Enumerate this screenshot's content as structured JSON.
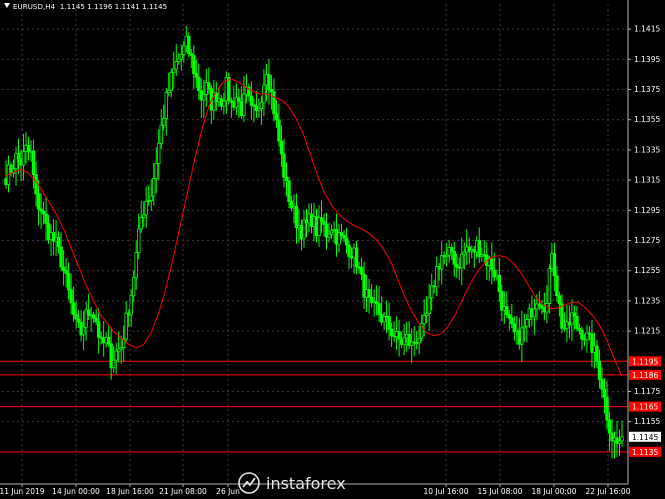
{
  "header": {
    "symbol_tf": "EURUSD,H4",
    "ohlc": "1.1145 1.1196 1.1141 1.1145"
  },
  "watermark": {
    "text": "instaforex"
  },
  "colors": {
    "background": "#000000",
    "candle": "#00ff00",
    "ma": "#ff0000",
    "level": "#ff0000",
    "grid": "#3a3a3a"
  },
  "chart_data": {
    "type": "candlestick",
    "symbol": "EURUSD",
    "timeframe": "H4",
    "y_axis": {
      "ticks": [
        "1.1415",
        "1.1395",
        "1.1375",
        "1.1355",
        "1.1335",
        "1.1315",
        "1.1295",
        "1.1275",
        "1.1255",
        "1.1235",
        "1.1215",
        "1.1175",
        "1.1155"
      ],
      "range": [
        1.1123,
        1.1425
      ],
      "current_price": "1.1145"
    },
    "x_axis": {
      "ticks": [
        "11 Jun 2019",
        "14 Jun 00:00",
        "18 Jun 16:00",
        "21 Jun 08:00",
        "26 Jun",
        "10 Jul 16:00",
        "15 Jul 08:00",
        "18 Jul 00:00",
        "22 Jul 16:00"
      ]
    },
    "levels": [
      {
        "price": 1.1195,
        "label": "1.1195"
      },
      {
        "price": 1.1186,
        "label": "1.1186"
      },
      {
        "price": 1.1165,
        "label": "1.1165"
      },
      {
        "price": 1.1135,
        "label": "1.1135"
      }
    ],
    "close_path": [
      1.1318,
      1.1322,
      1.133,
      1.1327,
      1.1335,
      1.1332,
      1.1302,
      1.1296,
      1.1284,
      1.1278,
      1.1272,
      1.1262,
      1.1248,
      1.1232,
      1.1218,
      1.1214,
      1.1225,
      1.123,
      1.1222,
      1.1205,
      1.1208,
      1.1196,
      1.1201,
      1.1205,
      1.1222,
      1.124,
      1.1265,
      1.129,
      1.1302,
      1.1306,
      1.1328,
      1.135,
      1.1368,
      1.1382,
      1.1392,
      1.1398,
      1.1405,
      1.1395,
      1.1382,
      1.137,
      1.1376,
      1.1366,
      1.1372,
      1.1368,
      1.1377,
      1.1365,
      1.137,
      1.1362,
      1.1372,
      1.136,
      1.1358,
      1.1372,
      1.139,
      1.1372,
      1.1352,
      1.133,
      1.131,
      1.1298,
      1.1288,
      1.1282,
      1.1285,
      1.129,
      1.1282,
      1.1287,
      1.128,
      1.1285,
      1.1278,
      1.1276,
      1.1272,
      1.1268,
      1.1262,
      1.1248,
      1.1238,
      1.1228,
      1.123,
      1.1224,
      1.122,
      1.1215,
      1.121,
      1.1208,
      1.121,
      1.1205,
      1.1211,
      1.1214,
      1.1225,
      1.124,
      1.1256,
      1.1265,
      1.1262,
      1.1268,
      1.1258,
      1.1264,
      1.127,
      1.1266,
      1.1272,
      1.1268,
      1.1262,
      1.1258,
      1.125,
      1.1234,
      1.1222,
      1.1215,
      1.121,
      1.1214,
      1.122,
      1.123,
      1.1238,
      1.1235,
      1.1232,
      1.127,
      1.1242,
      1.122,
      1.1215,
      1.1225,
      1.1218,
      1.1215,
      1.121,
      1.1205,
      1.1195,
      1.118,
      1.116,
      1.1145,
      1.114,
      1.1145
    ],
    "ma_series": [
      1.1318,
      1.132,
      1.1322,
      1.132,
      1.1315,
      1.1308,
      1.13,
      1.1292,
      1.1282,
      1.127,
      1.1258,
      1.1246,
      1.1236,
      1.1226,
      1.122,
      1.1214,
      1.121,
      1.1206,
      1.1204,
      1.1206,
      1.1214,
      1.1226,
      1.1242,
      1.1262,
      1.1284,
      1.1306,
      1.1328,
      1.1348,
      1.1364,
      1.1374,
      1.138,
      1.1382,
      1.138,
      1.1377,
      1.1374,
      1.1372,
      1.1372,
      1.137,
      1.1368,
      1.1364,
      1.1356,
      1.1346,
      1.1332,
      1.1318,
      1.1306,
      1.1298,
      1.1292,
      1.1288,
      1.1285,
      1.1283,
      1.128,
      1.1276,
      1.127,
      1.1262,
      1.125,
      1.1238,
      1.1228,
      1.122,
      1.1214,
      1.1212,
      1.1213,
      1.1218,
      1.1226,
      1.1236,
      1.1246,
      1.1254,
      1.126,
      1.1264,
      1.1265,
      1.1264,
      1.126,
      1.1254,
      1.1246,
      1.1238,
      1.1233,
      1.123,
      1.123,
      1.1232,
      1.1234,
      1.1234,
      1.123,
      1.1225,
      1.1218,
      1.1208,
      1.1196,
      1.1185
    ]
  }
}
